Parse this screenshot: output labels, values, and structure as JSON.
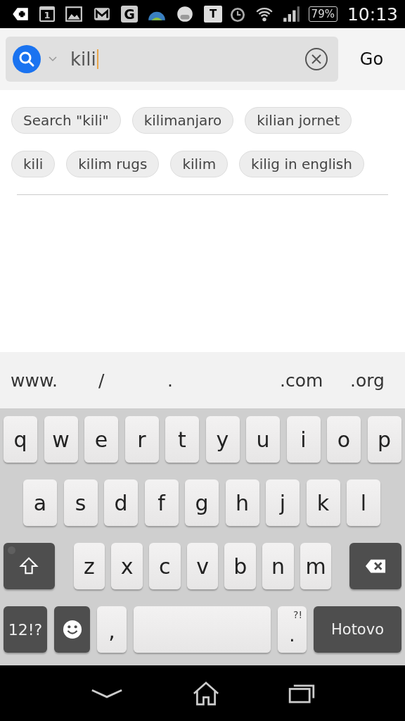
{
  "status_bar": {
    "notifications": [
      {
        "kind": "plus"
      },
      {
        "kind": "calendar",
        "label": "1"
      },
      {
        "kind": "image"
      },
      {
        "kind": "mail"
      },
      {
        "kind": "letter",
        "label": "G"
      },
      {
        "kind": "globe"
      },
      {
        "kind": "face"
      },
      {
        "kind": "chat",
        "label": "T"
      }
    ],
    "battery": "79%",
    "time": "10:13"
  },
  "search": {
    "value": "kili",
    "go": "Go"
  },
  "suggestions": [
    [
      "Search \"kili\"",
      "kilimanjaro",
      "kilian jornet"
    ],
    [
      "kili",
      "kilim rugs",
      "kilim",
      "kilig in english"
    ]
  ],
  "shortcuts": [
    "www.",
    "/",
    ".",
    ".com",
    ".org"
  ],
  "keyboard": {
    "rows": [
      {
        "keys": [
          {
            "kind": "letter",
            "label": "q"
          },
          {
            "kind": "letter",
            "label": "w"
          },
          {
            "kind": "letter",
            "label": "e"
          },
          {
            "kind": "letter",
            "label": "r"
          },
          {
            "kind": "letter",
            "label": "t"
          },
          {
            "kind": "letter",
            "label": "y"
          },
          {
            "kind": "letter",
            "label": "u"
          },
          {
            "kind": "letter",
            "label": "i"
          },
          {
            "kind": "letter",
            "label": "o"
          },
          {
            "kind": "letter",
            "label": "p"
          }
        ]
      },
      {
        "keys": [
          {
            "kind": "letter",
            "label": "a"
          },
          {
            "kind": "letter",
            "label": "s"
          },
          {
            "kind": "letter",
            "label": "d"
          },
          {
            "kind": "letter",
            "label": "f"
          },
          {
            "kind": "letter",
            "label": "g"
          },
          {
            "kind": "letter",
            "label": "h"
          },
          {
            "kind": "letter",
            "label": "j"
          },
          {
            "kind": "letter",
            "label": "k"
          },
          {
            "kind": "letter",
            "label": "l"
          }
        ]
      },
      {
        "keys": [
          {
            "kind": "shift"
          },
          {
            "kind": "letter",
            "label": "z"
          },
          {
            "kind": "letter",
            "label": "x"
          },
          {
            "kind": "letter",
            "label": "c"
          },
          {
            "kind": "letter",
            "label": "v"
          },
          {
            "kind": "letter",
            "label": "b"
          },
          {
            "kind": "letter",
            "label": "n"
          },
          {
            "kind": "letter",
            "label": "m"
          },
          {
            "kind": "backspace"
          }
        ]
      },
      {
        "keys": [
          {
            "kind": "symbols",
            "label": "12!?"
          },
          {
            "kind": "emoji"
          },
          {
            "kind": "comma",
            "label": ","
          },
          {
            "kind": "space"
          },
          {
            "kind": "period",
            "label": ".",
            "hint": "?!"
          },
          {
            "kind": "done",
            "label": "Hotovo"
          }
        ]
      }
    ]
  }
}
